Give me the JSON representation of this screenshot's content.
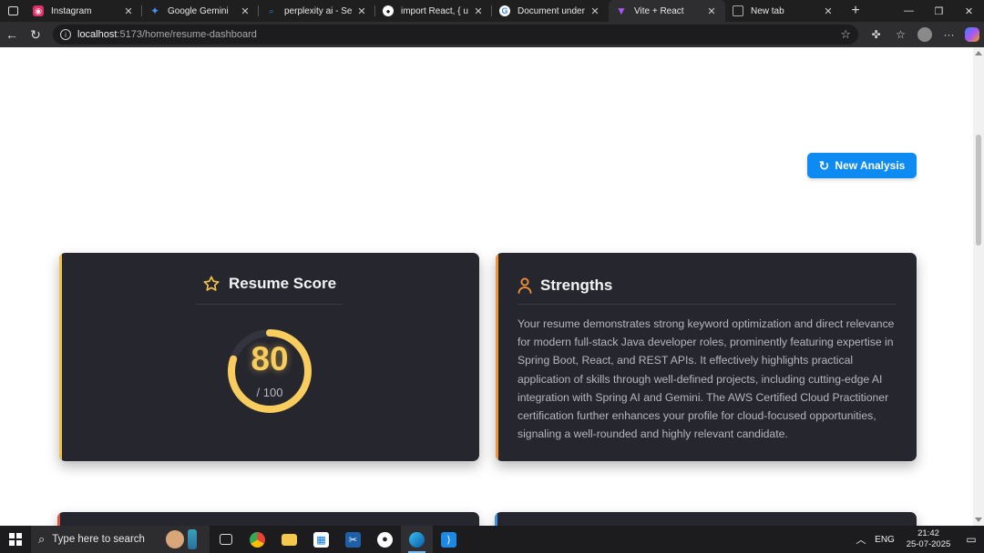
{
  "browser": {
    "tabs": [
      {
        "title": "Instagram",
        "favicon": "instagram-icon",
        "color": "#e1306c",
        "active": false
      },
      {
        "title": "Google Gemini",
        "favicon": "gemini-icon",
        "color": "#4c8df6",
        "active": false
      },
      {
        "title": "perplexity ai - Search",
        "favicon": "search-icon",
        "color": "#3b82f6",
        "active": false
      },
      {
        "title": "import React, { useStat",
        "favicon": "github-icon",
        "color": "#ffffff",
        "active": false
      },
      {
        "title": "Document understand",
        "favicon": "google-icon",
        "color": "#ffffff",
        "active": false
      },
      {
        "title": "Vite + React",
        "favicon": "vite-icon",
        "color": "#a855f7",
        "active": true
      },
      {
        "title": "New tab",
        "favicon": "page-icon",
        "color": "#9aa0a6",
        "active": false
      }
    ],
    "address": {
      "host": "localhost",
      "path": ":5173/home/resume-dashboard"
    }
  },
  "page": {
    "new_analysis_label": "New Analysis",
    "score_card": {
      "title": "Resume Score",
      "score": "80",
      "max_label": "/ 100",
      "score_value": 80,
      "score_max": 100,
      "accent": "#f5c04a"
    },
    "strengths_card": {
      "title": "Strengths",
      "body": "Your resume demonstrates strong keyword optimization and direct relevance for modern full-stack Java developer roles, prominently featuring expertise in Spring Boot, React, and REST APIs. It effectively highlights practical application of skills through well-defined projects, including cutting-edge AI integration with Spring AI and Gemini. The AWS Certified Cloud Practitioner certification further enhances your profile for cloud-focused opportunities, signaling a well-rounded and highly relevant candidate.",
      "accent": "#f0943a"
    }
  },
  "taskbar": {
    "search_placeholder": "Type here to search",
    "language": "ENG",
    "time": "21:42",
    "date": "25-07-2025"
  }
}
